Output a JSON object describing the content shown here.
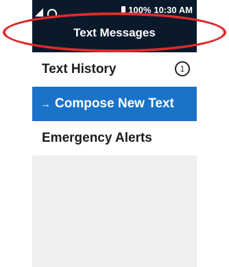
{
  "status_bar": {
    "battery_text": "100%",
    "time": "10:30 AM",
    "icons": [
      "signal-icon",
      "wifi-icon",
      "battery-icon"
    ]
  },
  "header": {
    "title": "Text Messages"
  },
  "menu": {
    "items": [
      {
        "label": "Text History",
        "badge": "1",
        "selected": false
      },
      {
        "label": "Compose New Text",
        "arrow": "→",
        "selected": true
      },
      {
        "label": "Emergency Alerts",
        "selected": false
      }
    ]
  },
  "colors": {
    "header_bg": "#0b1a2b",
    "selected_bg": "#1a73c9",
    "highlight_ring": "#e02a2a"
  }
}
